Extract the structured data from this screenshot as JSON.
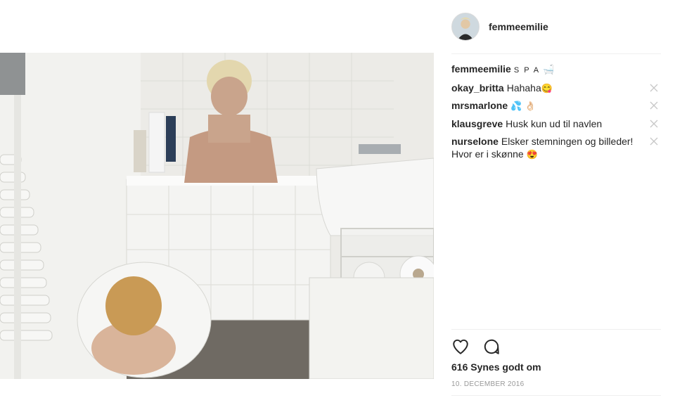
{
  "post": {
    "username": "femmeemilie",
    "photo_alt": "bathroom photo"
  },
  "caption": {
    "author": "femmeemilie",
    "text": "S P A",
    "emoji": "🛁"
  },
  "comments": [
    {
      "author": "okay_britta",
      "text": "Hahaha",
      "emoji": "😋"
    },
    {
      "author": "mrsmarlone",
      "text": "",
      "emoji": "💦 👌🏻"
    },
    {
      "author": "klausgreve",
      "text": "Husk kun ud til navlen",
      "emoji": ""
    },
    {
      "author": "nurselone",
      "text": "Elsker stemningen og billeder! Hvor er i skønne",
      "emoji": "😍"
    }
  ],
  "actions": {
    "like_icon": "heart-icon",
    "comment_icon": "comment-icon"
  },
  "likes_text": "616 Synes godt om",
  "date_text": "10. DECEMBER 2016",
  "colors": {
    "text": "#262626",
    "muted": "#999999",
    "divider": "#efefef"
  }
}
